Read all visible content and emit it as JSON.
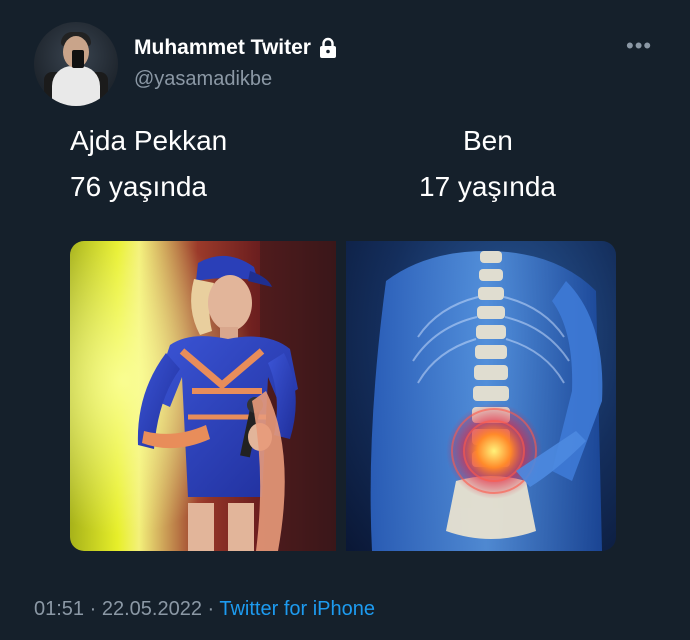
{
  "tweet": {
    "display_name": "Muhammet Twiter",
    "handle": "@yasamadikbe",
    "left_caption": {
      "name": "Ajda Pekkan",
      "age": "76 yaşında"
    },
    "right_caption": {
      "name": "Ben",
      "age": "17 yaşında"
    },
    "more_label": "•••",
    "time": "01:51",
    "separator": " · ",
    "date": "22.05.2022",
    "source": "Twitter for iPhone"
  },
  "icons": {
    "lock": "lock-icon",
    "more": "more-icon"
  },
  "colors": {
    "background": "#15202b",
    "secondary_text": "#8b98a5",
    "link": "#1d9bf0"
  }
}
